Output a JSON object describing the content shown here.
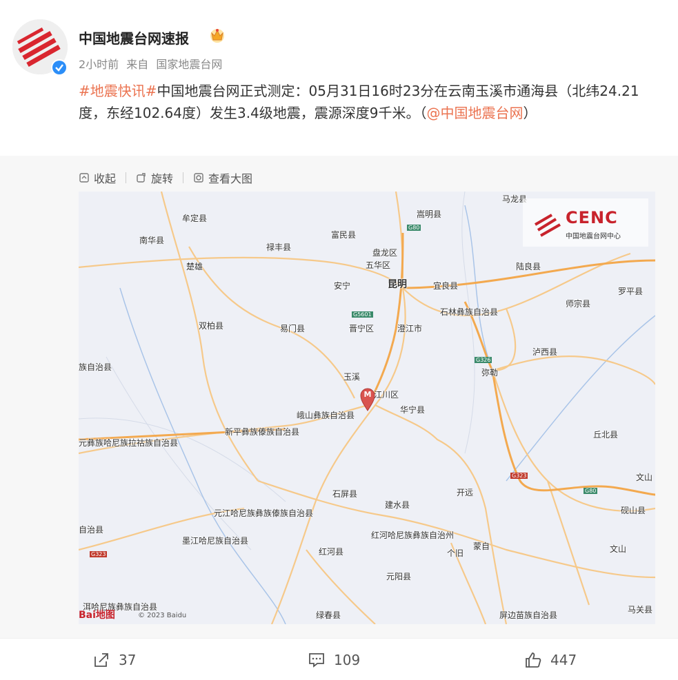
{
  "user": {
    "name": "中国地震台网速报",
    "time": "2小时前",
    "source_prefix": "来自",
    "source": "国家地震台网"
  },
  "post": {
    "tag": "#地震快讯#",
    "text": "中国地震台网正式测定：05月31日16时23分在云南玉溪市通海县（北纬24.21度，东经102.64度）发生3.4级地震，震源深度9千米。（",
    "mention": "@中国地震台网",
    "suffix": "）"
  },
  "toolbar": {
    "collapse": "收起",
    "rotate": "旋转",
    "view_large": "查看大图"
  },
  "map": {
    "badge_title": "CENC",
    "badge_sub": "中国地震台网中心",
    "marker_letter": "M",
    "baidu_logo": "Bai地图",
    "copyright": "© 2023 Baidu",
    "labels": {
      "malong": "马龙县",
      "chuanming": "嵩明县",
      "mouding": "牟定县",
      "nanhua": "南华县",
      "lufeng": "禄丰县",
      "fumin": "富民县",
      "panlong": "盘龙区",
      "wuhua": "五华区",
      "chuxiong": "楚雄",
      "anning": "安宁",
      "kunming": "昆明",
      "yiliang": "宜良县",
      "luliang": "陆良县",
      "luoping": "罗平县",
      "shizong": "师宗县",
      "shuangbai": "双柏县",
      "yimen": "易门县",
      "jinning": "晋宁区",
      "chengjiang": "澄江市",
      "shilin": "石林彝族自治县",
      "luxi": "泸西县",
      "zhenzizhi": "族自治县",
      "mile": "弥勒",
      "yuxi": "玉溪",
      "jiangchuan": "江川区",
      "huaning": "华宁县",
      "eshan": "峨山彝族自治县",
      "xinping": "新平彝族傣族自治县",
      "qiubei": "丘北县",
      "yuanjiang_hani": "元彝族哈尼族拉祜族自治县",
      "wenshan_top": "文山",
      "shiping": "石屏县",
      "kaiyuan": "开远",
      "jianshui": "建水县",
      "yuanjiang": "元江哈尼族彝族傣族自治县",
      "yanshan": "砚山县",
      "zizhixian": "自治县",
      "honghe_pref": "红河哈尼族彝族自治州",
      "mojiang": "墨江哈尼族自治县",
      "gejiu": "个旧",
      "mengzi": "蒙自",
      "honghe": "红河县",
      "wenshan2": "文山",
      "yuanyang": "元阳县",
      "ning_er": "洱哈尼族彝族自治县",
      "lvchun": "绿春县",
      "pingbian": "屏边苗族自治县",
      "maguan": "马关县",
      "g5601": "G5601",
      "g80_1": "G80",
      "g80_2": "G80",
      "g323_1": "G323",
      "g323_2": "G323",
      "g326": "G326"
    }
  },
  "actions": {
    "share": "37",
    "comment": "109",
    "like": "447"
  }
}
